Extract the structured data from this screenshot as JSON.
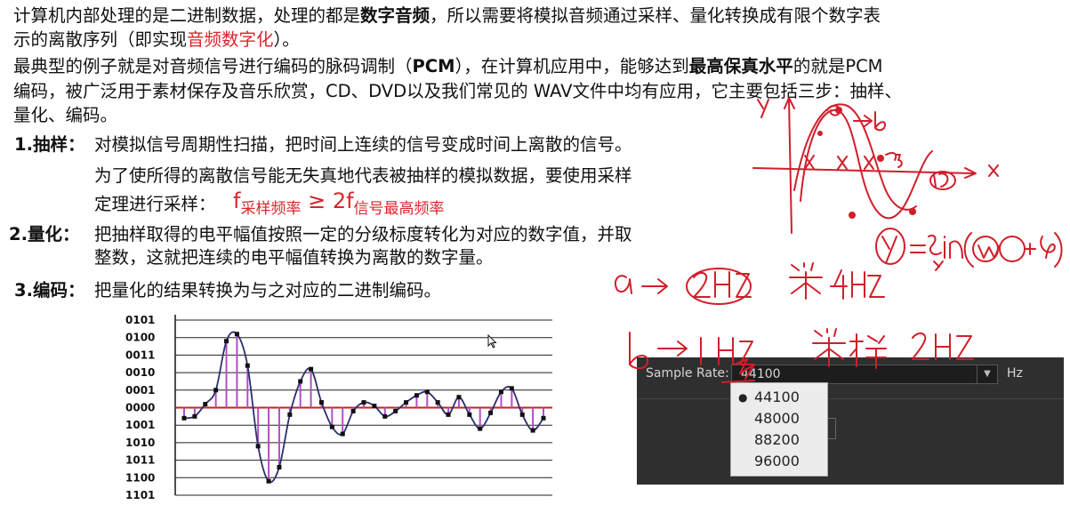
{
  "intro": {
    "p1_l1_a": "计算机内部处理的是二进制数据，处理的都是",
    "p1_l1_b": "数字音频",
    "p1_l1_c": "，所以需要将模拟音频通过采样、量化转换成有限个数字表",
    "p1_l2_a": "示的离散序列（即实现",
    "p1_l2_b": "音频数字化",
    "p1_l2_c": "）。",
    "p2_l1_a": "最典型的例子就是对音频信号进行编码的脉码调制（",
    "p2_l1_b": "PCM",
    "p2_l1_c": "），在计算机应用中，能够达到",
    "p2_l1_d": "最高保真水平",
    "p2_l1_e": "的就是PCM",
    "p2_l2": "编码，被广泛用于素材保存及音乐欣赏，CD、DVD以及我们常见的 WAV文件中均有应用，它主要包括三步：抽样、",
    "p2_l3": "量化、编码。"
  },
  "steps": {
    "s1_label": "1.抽样：",
    "s1_l1": "对模拟信号周期性扫描，把时间上连续的信号变成时间上离散的信号。",
    "s1_l2": "为了使所得的离散信号能无失真地代表被抽样的模拟数据，要使用采样",
    "s1_l3": "定理进行采样：",
    "formula_f1": "f",
    "formula_sub1": "采样频率",
    "formula_op": " ≥ 2f",
    "formula_sub2": "信号最高频率",
    "s2_label": "2.量化：",
    "s2_l1": "把抽样取得的电平幅值按照一定的分级标度转化为对应的数字值，并取",
    "s2_l2": "整数，这就把连续的电平幅值转换为离散的数字量。",
    "s3_label": "3.编码：",
    "s3_l1": "把量化的结果转换为与之对应的二进制编码。"
  },
  "chart_data": {
    "type": "line",
    "y_tick_labels": [
      "0101",
      "0100",
      "0011",
      "0010",
      "0001",
      "0000",
      "1001",
      "1010",
      "1011",
      "1100",
      "1101"
    ],
    "y_levels": [
      5,
      4,
      3,
      2,
      1,
      0,
      -1,
      -2,
      -3,
      -4,
      -5
    ],
    "samples": [
      -0.6,
      -0.5,
      0.2,
      1.0,
      3.8,
      4.2,
      2.4,
      -2.2,
      -4.2,
      -3.4,
      -0.4,
      1.5,
      2.2,
      0.3,
      -1.1,
      -1.5,
      -0.2,
      0.3,
      0.1,
      -0.5,
      -0.2,
      0.3,
      0.7,
      0.9,
      0.3,
      -0.4,
      0.6,
      -0.4,
      -1.2,
      -0.3,
      0.9,
      1.1,
      -0.4,
      -1.3,
      -0.6
    ],
    "colors": {
      "curve": "#2a2f6e",
      "stems": "#b34fc4",
      "baseline": "#c0261f",
      "points": "#111111"
    }
  },
  "sample_rate": {
    "label": "Sample Rate:",
    "value": "44100",
    "unit": "Hz",
    "options": [
      "44100",
      "48000",
      "88200",
      "96000"
    ],
    "selected_index": 0
  },
  "annotations": {
    "color": "#d11e2a"
  }
}
